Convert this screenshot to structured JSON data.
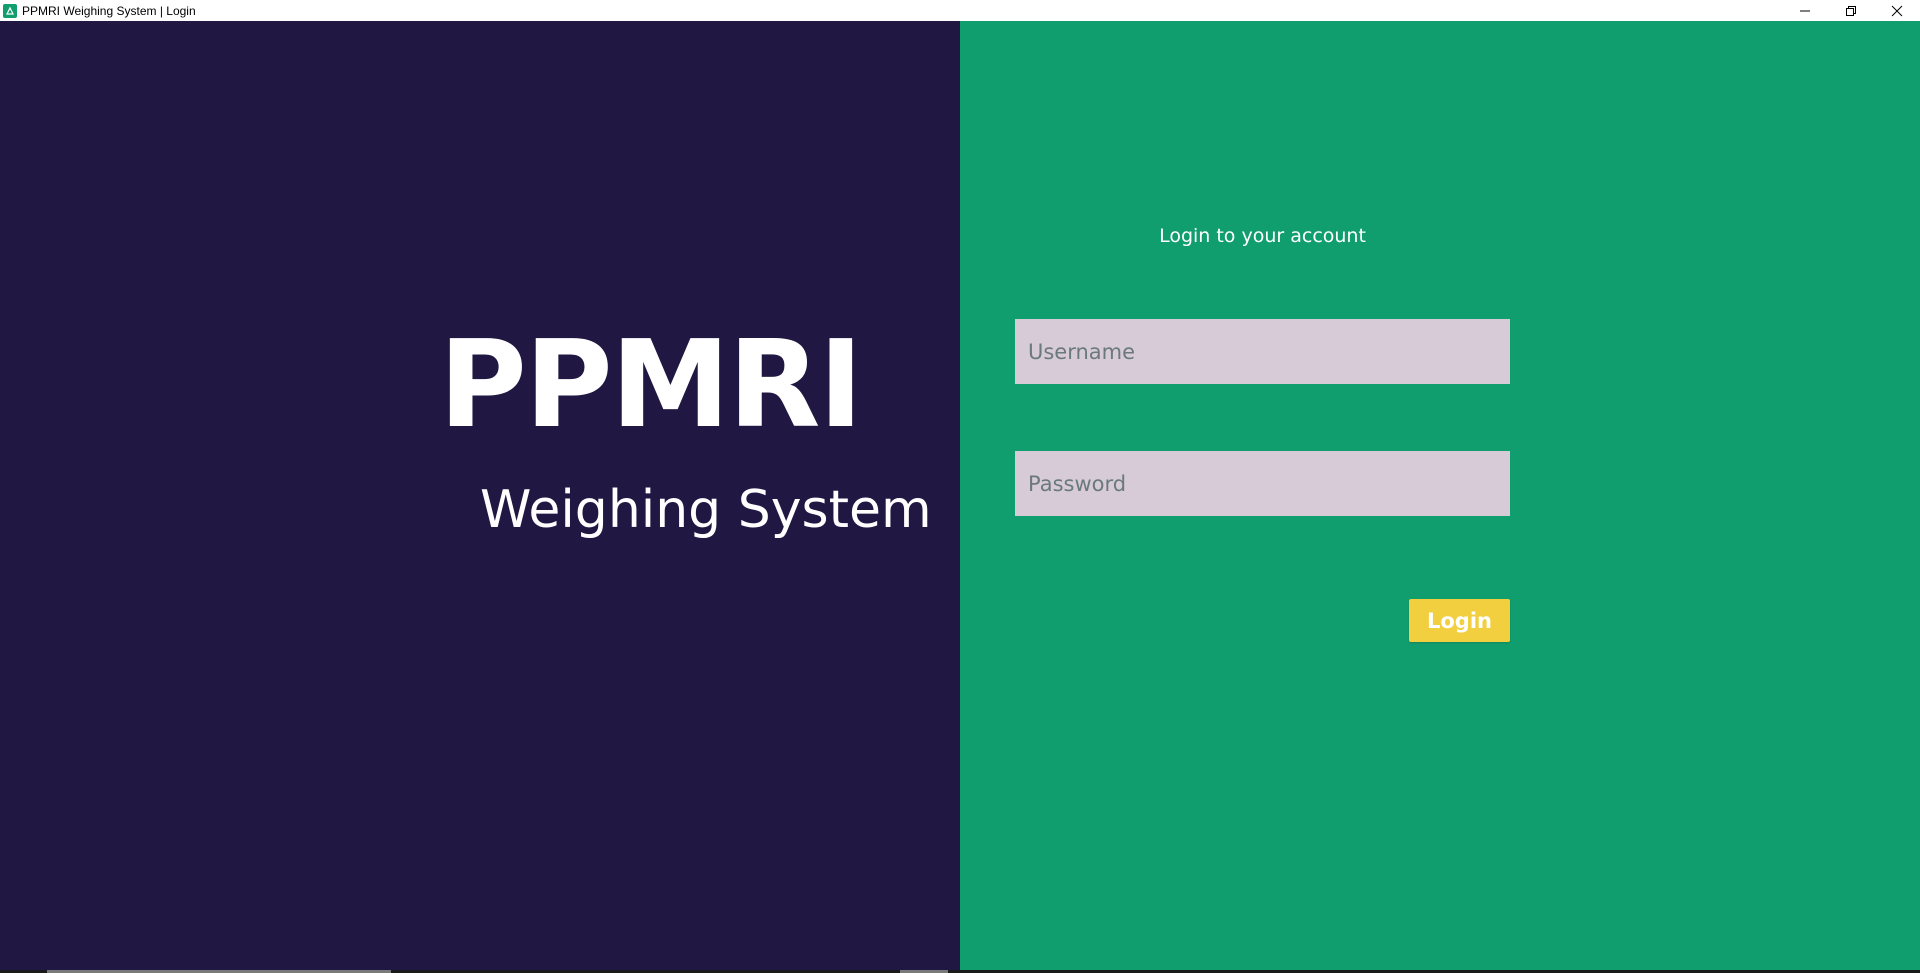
{
  "window": {
    "title": "PPMRI Weighing System | Login",
    "app_icon": "recycle-scale-icon",
    "controls": [
      "minimize-icon",
      "restore-icon",
      "close-icon"
    ]
  },
  "brand": {
    "title": "PPMRI",
    "subtitle": "Weighing System"
  },
  "login": {
    "heading": "Login to your account",
    "username": {
      "placeholder": "Username",
      "value": ""
    },
    "password": {
      "placeholder": "Password",
      "value": ""
    },
    "button_label": "Login"
  },
  "colors": {
    "left_panel": "#201742",
    "right_panel": "#119e6e",
    "input_background": "#d8cbd8",
    "button": "#f2cf3f",
    "text": "#ffffff"
  }
}
